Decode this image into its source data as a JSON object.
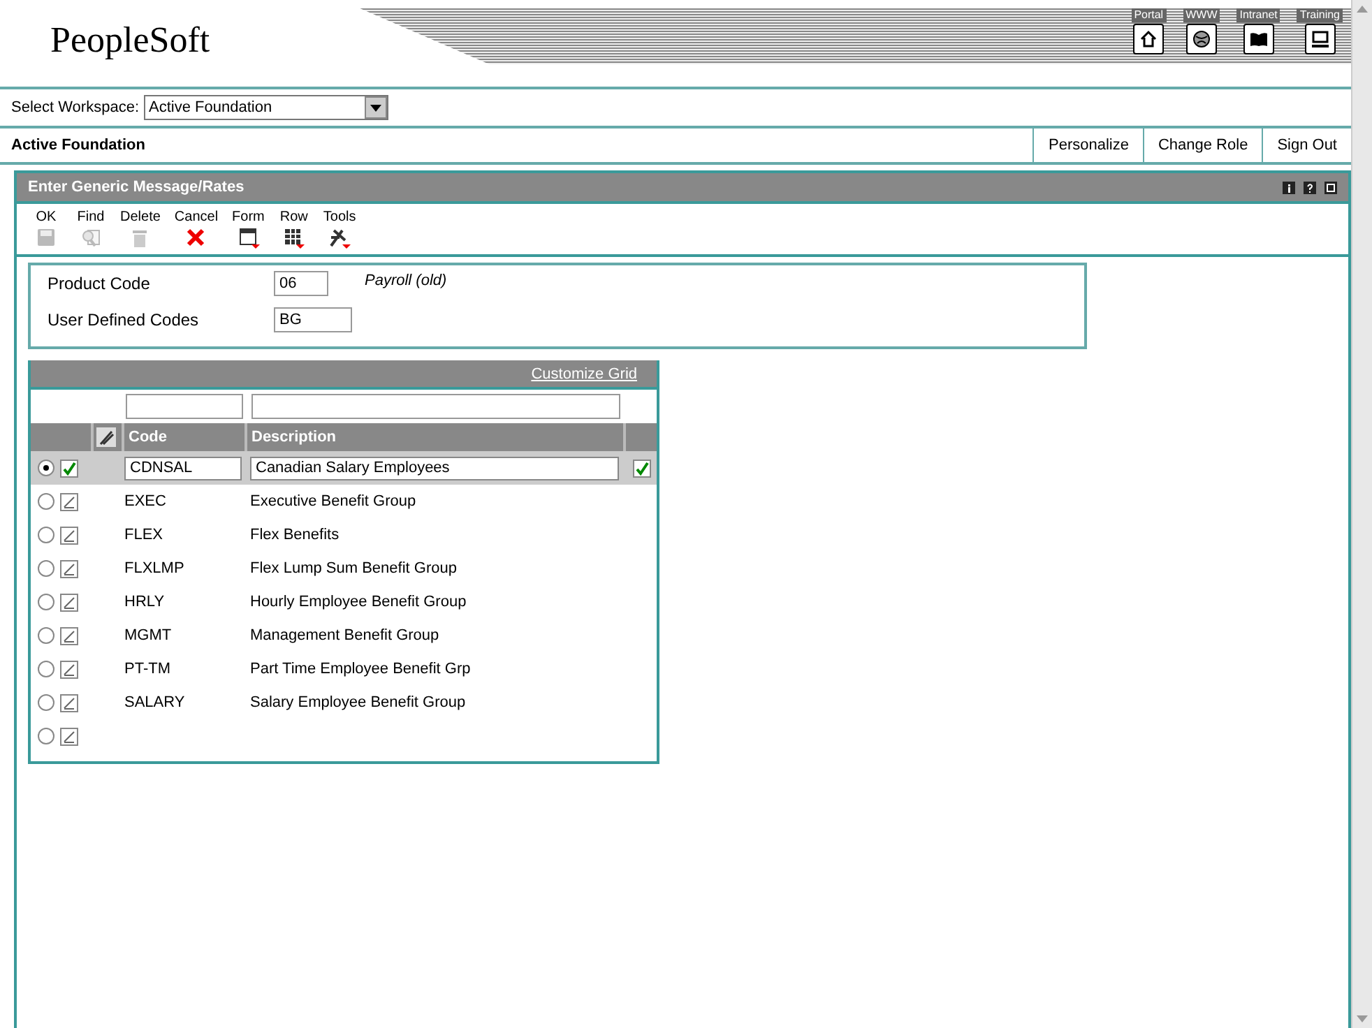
{
  "logo": "PeopleSoft",
  "nav": [
    {
      "label": "Portal",
      "kind": "home"
    },
    {
      "label": "WWW",
      "kind": "globe"
    },
    {
      "label": "Intranet",
      "kind": "book"
    },
    {
      "label": "Training",
      "kind": "screen"
    }
  ],
  "workspace": {
    "label": "Select Workspace:",
    "value": "Active Foundation"
  },
  "role_bar": {
    "title": "Active Foundation",
    "links": [
      "Personalize",
      "Change Role",
      "Sign Out"
    ]
  },
  "form": {
    "title": "Enter Generic Message/Rates",
    "toolbar": [
      {
        "label": "OK",
        "kind": "save",
        "disabled": true
      },
      {
        "label": "Find",
        "kind": "find",
        "disabled": true
      },
      {
        "label": "Delete",
        "kind": "delete",
        "disabled": true
      },
      {
        "label": "Cancel",
        "kind": "cancel",
        "disabled": false
      },
      {
        "label": "Form",
        "kind": "form",
        "disabled": false
      },
      {
        "label": "Row",
        "kind": "row",
        "disabled": false
      },
      {
        "label": "Tools",
        "kind": "tools",
        "disabled": false
      }
    ],
    "fields": [
      {
        "label": "Product Code",
        "value": "06",
        "description": "Payroll (old)"
      },
      {
        "label": "User Defined Codes",
        "value": "BG"
      }
    ],
    "grid": {
      "customize_link": "Customize Grid",
      "columns": [
        "Code",
        "Description"
      ],
      "rows": [
        {
          "selected": true,
          "code": "CDNSAL",
          "description": "Canadian Salary Employees"
        },
        {
          "selected": false,
          "code": "EXEC",
          "description": "Executive Benefit Group"
        },
        {
          "selected": false,
          "code": "FLEX",
          "description": "Flex Benefits"
        },
        {
          "selected": false,
          "code": "FLXLMP",
          "description": "Flex Lump Sum Benefit Group"
        },
        {
          "selected": false,
          "code": "HRLY",
          "description": "Hourly Employee Benefit Group"
        },
        {
          "selected": false,
          "code": "MGMT",
          "description": "Management Benefit Group"
        },
        {
          "selected": false,
          "code": "PT-TM",
          "description": "Part Time Employee Benefit Grp"
        },
        {
          "selected": false,
          "code": "SALARY",
          "description": "Salary Employee Benefit Group"
        },
        {
          "selected": false
        }
      ]
    }
  }
}
